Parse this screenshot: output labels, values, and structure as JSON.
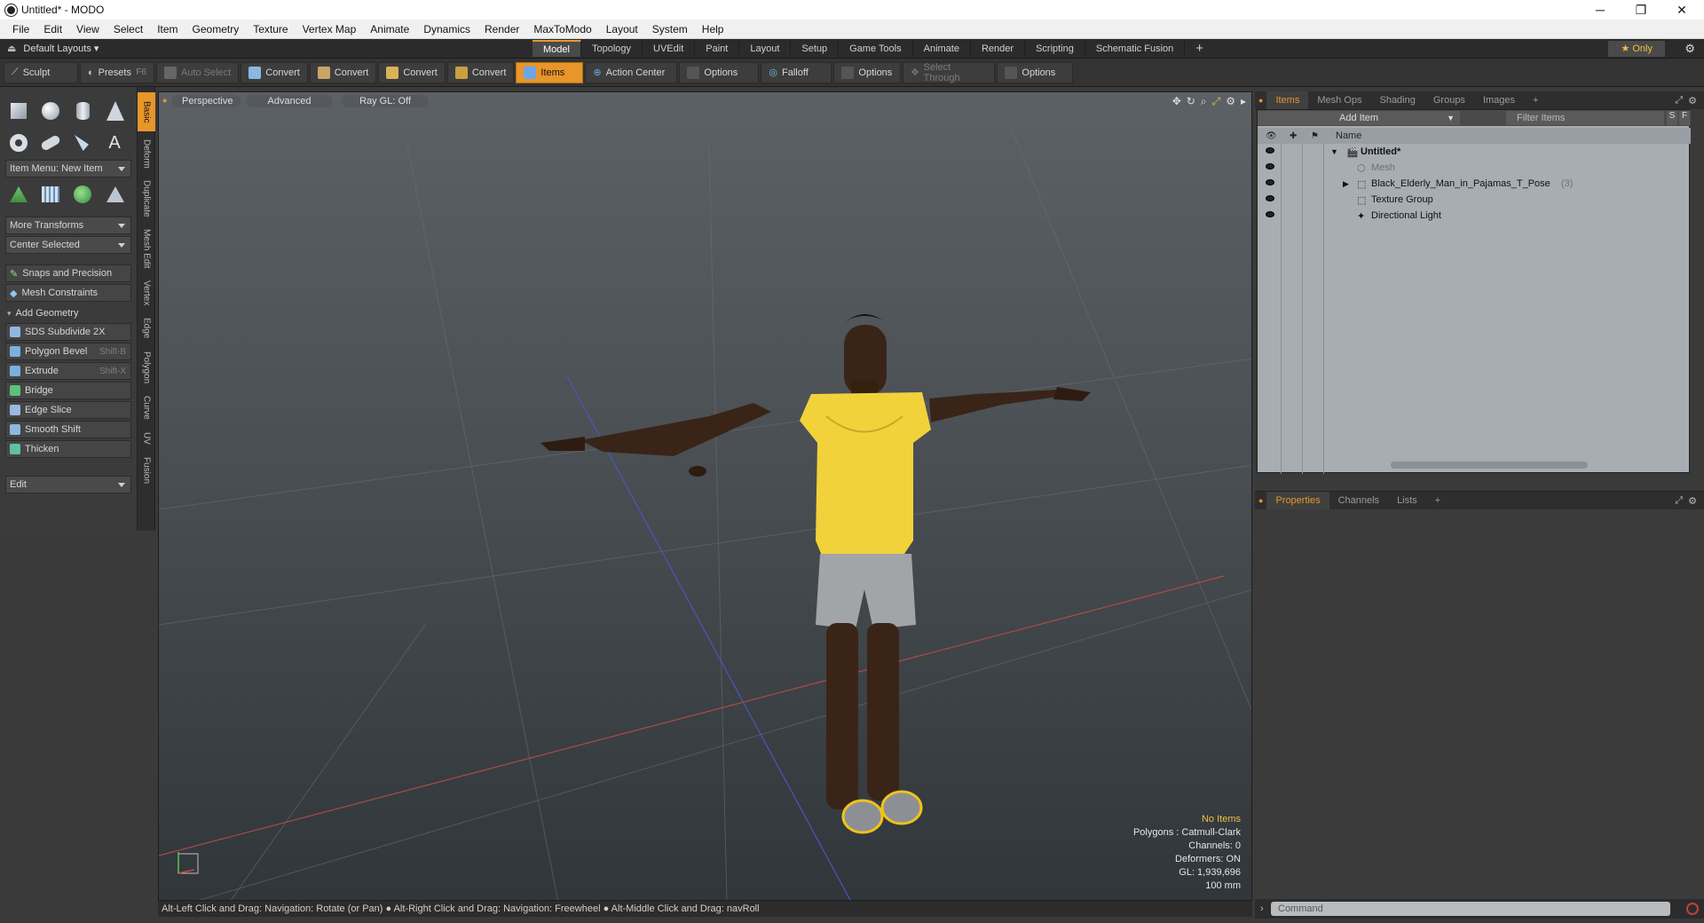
{
  "window": {
    "title": "Untitled* - MODO",
    "minimize": "─",
    "restore": "❐",
    "close": "✕"
  },
  "menu": [
    "File",
    "Edit",
    "View",
    "Select",
    "Item",
    "Geometry",
    "Texture",
    "Vertex Map",
    "Animate",
    "Dynamics",
    "Render",
    "MaxToModo",
    "Layout",
    "System",
    "Help"
  ],
  "layout": {
    "preset": "Default Layouts ▾",
    "tabs": [
      "Model",
      "Topology",
      "UVEdit",
      "Paint",
      "Layout",
      "Setup",
      "Game Tools",
      "Animate",
      "Render",
      "Scripting",
      "Schematic Fusion"
    ],
    "active_tab": "Model",
    "add": "+",
    "only": "★ Only"
  },
  "toolbar": {
    "sculpt": "Sculpt",
    "presets": "Presets",
    "presets_key": "F6",
    "auto_select": "Auto Select",
    "convert1": "Convert",
    "convert2": "Convert",
    "convert3": "Convert",
    "convert4": "Convert",
    "items": "Items",
    "action_center": "Action Center",
    "options1": "Options",
    "falloff": "Falloff",
    "options2": "Options",
    "select_through": "Select Through",
    "options3": "Options"
  },
  "leftpanel": {
    "item_menu": "Item Menu: New Item",
    "more_transforms": "More Transforms",
    "center_selected": "Center Selected",
    "snaps": "Snaps and Precision",
    "mesh_constraints": "Mesh Constraints",
    "add_geometry": "Add Geometry",
    "tools": [
      {
        "label": "SDS Subdivide 2X",
        "shortcut": ""
      },
      {
        "label": "Polygon Bevel",
        "shortcut": "Shift-B"
      },
      {
        "label": "Extrude",
        "shortcut": "Shift-X"
      },
      {
        "label": "Bridge",
        "shortcut": ""
      },
      {
        "label": "Edge Slice",
        "shortcut": ""
      },
      {
        "label": "Smooth Shift",
        "shortcut": ""
      },
      {
        "label": "Thicken",
        "shortcut": ""
      }
    ],
    "edit": "Edit",
    "vtabs": [
      "Basic",
      "Deform",
      "Duplicate",
      "Mesh Edit",
      "Vertex",
      "Edge",
      "Polygon",
      "Curve",
      "UV",
      "Fusion"
    ]
  },
  "viewport": {
    "perspective": "Perspective",
    "advanced": "Advanced",
    "raygl": "Ray GL: Off",
    "hud": {
      "no_items": "No Items",
      "polygons": "Polygons : Catmull-Clark",
      "channels": "Channels: 0",
      "deformers": "Deformers: ON",
      "gl": "GL: 1,939,696",
      "scale": "100 mm"
    }
  },
  "status": "Alt-Left Click and Drag: Navigation: Rotate (or Pan) ● Alt-Right Click and Drag: Navigation: Freewheel ● Alt-Middle Click and Drag: navRoll",
  "items_panel": {
    "tabs": [
      "Items",
      "Mesh Ops",
      "Shading",
      "Groups",
      "Images",
      "+"
    ],
    "add_item": "Add Item",
    "filter": "Filter Items",
    "s": "S",
    "f": "F",
    "name_header": "Name",
    "tree": [
      {
        "label": "Untitled*",
        "level": 0,
        "bold": true,
        "dim": false,
        "count": ""
      },
      {
        "label": "Mesh",
        "level": 1,
        "bold": false,
        "dim": true,
        "count": ""
      },
      {
        "label": "Black_Elderly_Man_in_Pajamas_T_Pose",
        "level": 1,
        "bold": false,
        "dim": false,
        "count": "(3)"
      },
      {
        "label": "Texture Group",
        "level": 1,
        "bold": false,
        "dim": false,
        "count": ""
      },
      {
        "label": "Directional Light",
        "level": 1,
        "bold": false,
        "dim": false,
        "count": ""
      }
    ]
  },
  "props_panel": {
    "tabs": [
      "Properties",
      "Channels",
      "Lists",
      "+"
    ]
  },
  "command": {
    "placeholder": "Command"
  },
  "colors": {
    "accent": "#e8952a",
    "shirt": "#f2d23a",
    "skin": "#3a2418"
  }
}
